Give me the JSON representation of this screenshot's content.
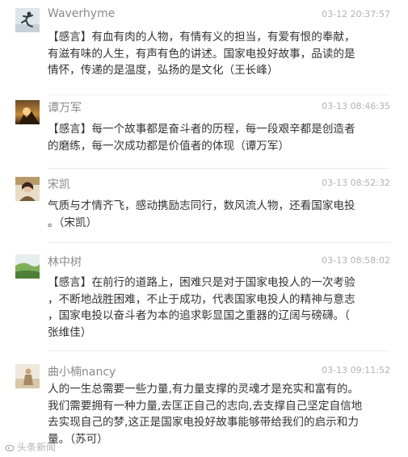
{
  "comments": [
    {
      "name": "Waverhyme",
      "time": "03-12 20:37:57",
      "lines": [
        "【感言】有血有肉的人物，有情有义的担当，有爱有恨的奉献，",
        "有滋有味的人生，有声有色的讲述。国家电投好故事，品读的是",
        "情怀，传递的是温度，弘扬的是文化（王长峰）"
      ]
    },
    {
      "name": "谭万军",
      "time": "03-13 08:46:35",
      "lines": [
        "【感言】每一个故事都是奋斗者的历程，每一段艰辛都是创造者",
        "的磨练，每一次成功都是价值者的体现（谭万军）"
      ]
    },
    {
      "name": "宋凯",
      "time": "03-13 08:52:32",
      "lines": [
        "气质与才情齐飞，感动携励志同行，数风流人物，还看国家电投",
        "。（宋凯）"
      ]
    },
    {
      "name": "林中树",
      "time": "03-13 08:58:02",
      "lines": [
        "【感言】在前行的道路上，困难只是对于国家电投人的一次考验",
        "，不断地战胜困难，不止于成功，代表国家电投人的精神与意志",
        "，国家电投以奋斗者为本的追求彰显国之重器的辽阔与磅礴。（",
        "张维佳）"
      ]
    },
    {
      "name": "曲小楠nancy",
      "time": "03-13 09:11:52",
      "lines": [
        "人的一生总需要一些力量,有力量支撑的灵魂才是充实和富有的。",
        "我们需要拥有一种力量,去匡正自己的志向,去支撑自己坚定自信地",
        "去实现自己的梦,这正是国家电投好故事能够带给我们的启示和力",
        "量。（苏可）"
      ]
    }
  ],
  "watermark": "头条新闻"
}
